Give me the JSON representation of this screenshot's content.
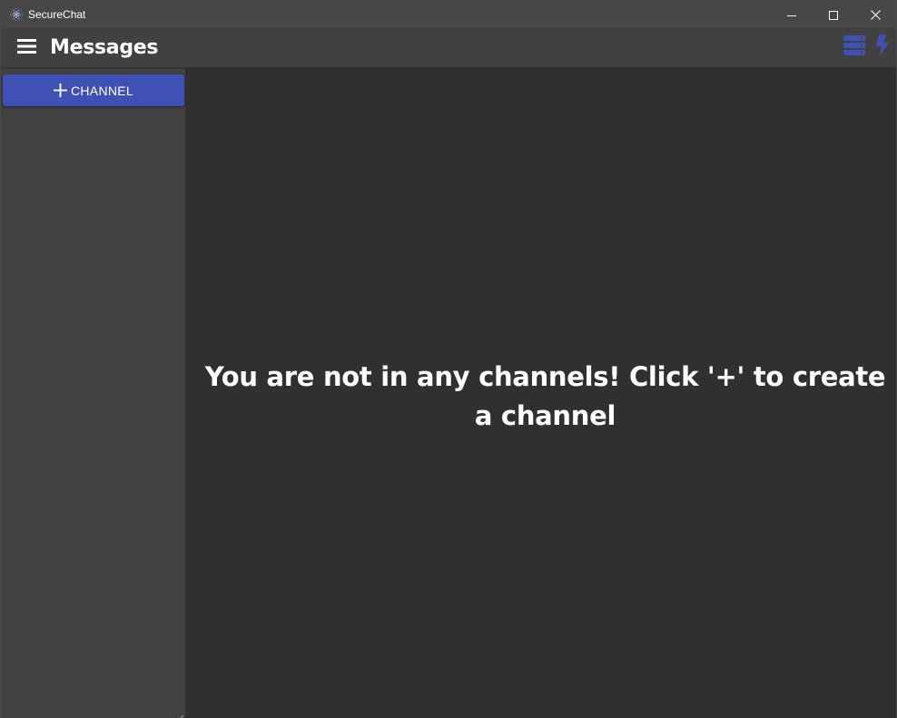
{
  "window": {
    "title": "SecureChat",
    "app_icon": "electron-atom-icon",
    "controls": [
      "minimize-icon",
      "maximize-icon",
      "close-icon"
    ]
  },
  "appbar": {
    "menu_icon": "hamburger-menu-icon",
    "title": "Messages",
    "actions": [
      "server-stack-icon",
      "lightning-bolt-icon"
    ],
    "accent_color": "#3f51b5"
  },
  "sidebar": {
    "add_channel_icon": "plus-icon",
    "add_channel_label": "CHANNEL",
    "button_color": "#3f51b5"
  },
  "main": {
    "empty_message": "You are not in any channels! Click '+' to create a channel"
  },
  "colors": {
    "titlebar": "#474747",
    "appbar": "#414141",
    "sidebar": "#424242",
    "main": "#303030",
    "text": "#ffffff"
  }
}
